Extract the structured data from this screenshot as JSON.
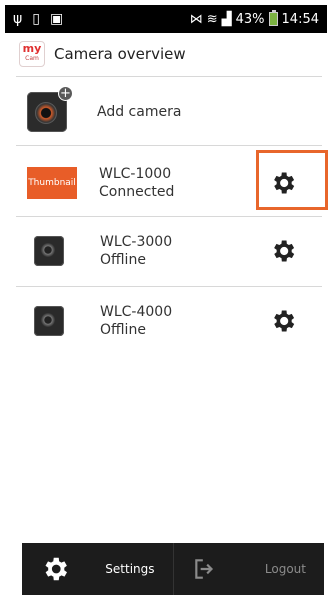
{
  "status_bar": {
    "left_icons": [
      "usb-icon",
      "notification-icon",
      "screenshot-icon"
    ],
    "battery": "43%",
    "time": "14:54",
    "icons": [
      "vibrate-icon",
      "wifi-icon",
      "signal-icon",
      "battery-icon"
    ]
  },
  "app_bar": {
    "logo_text": "my",
    "logo_sub": "Cam",
    "title": "Camera overview"
  },
  "add_camera": {
    "label": "Add camera",
    "icon": "camera-add-icon"
  },
  "cameras": [
    {
      "name": "WLC-1000",
      "status": "Connected",
      "thumbnail_label": "Thumbnail",
      "settings_icon": "gear-icon"
    },
    {
      "name": "WLC-3000",
      "status": "Offline",
      "settings_icon": "gear-icon"
    },
    {
      "name": "WLC-4000",
      "status": "Offline",
      "settings_icon": "gear-icon"
    }
  ],
  "bottom_nav": {
    "settings_label": "Settings",
    "logout_label": "Logout"
  },
  "colors": {
    "accent": "#e8662b",
    "thumbnail_bg": "#e85d28",
    "nav_bg": "#1c1c1c"
  }
}
